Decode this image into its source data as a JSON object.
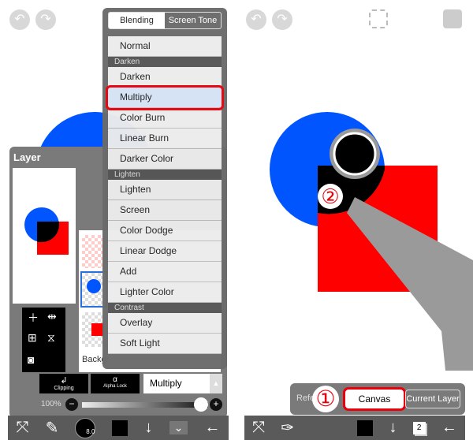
{
  "left": {
    "popup": {
      "tabs": [
        {
          "label": "Blending Mode",
          "selected": true
        },
        {
          "label": "Screen Tone",
          "selected": false
        }
      ],
      "items": [
        {
          "type": "item",
          "label": "Normal"
        },
        {
          "type": "header",
          "label": "Darken"
        },
        {
          "type": "item",
          "label": "Darken"
        },
        {
          "type": "item",
          "label": "Multiply",
          "selected": true
        },
        {
          "type": "item",
          "label": "Color Burn"
        },
        {
          "type": "item",
          "label": "Linear Burn"
        },
        {
          "type": "item",
          "label": "Darker Color"
        },
        {
          "type": "header",
          "label": "Lighten"
        },
        {
          "type": "item",
          "label": "Lighten"
        },
        {
          "type": "item",
          "label": "Screen"
        },
        {
          "type": "item",
          "label": "Color Dodge"
        },
        {
          "type": "item",
          "label": "Linear Dodge"
        },
        {
          "type": "item",
          "label": "Add"
        },
        {
          "type": "item",
          "label": "Lighter Color"
        },
        {
          "type": "header",
          "label": "Contrast"
        },
        {
          "type": "item",
          "label": "Overlay"
        },
        {
          "type": "item",
          "label": "Soft Light"
        }
      ]
    },
    "layer_panel": {
      "title": "Layer",
      "background_label": "Backgr",
      "clipping": "Clipping",
      "alpha_lock": "Alpha Lock",
      "blend_mode": "Multiply",
      "opacity": "100%",
      "opacity_value": 100
    },
    "brush_size": "8.0"
  },
  "right": {
    "reference": {
      "label": "Refe",
      "options": [
        "Canvas",
        "Current Layer"
      ],
      "selected": "Canvas"
    },
    "layer_count": "2",
    "step1": "①",
    "step2": "②"
  },
  "colors": {
    "blue": "#0055ff",
    "red": "#ff0000",
    "highlight": "#e8000b"
  }
}
